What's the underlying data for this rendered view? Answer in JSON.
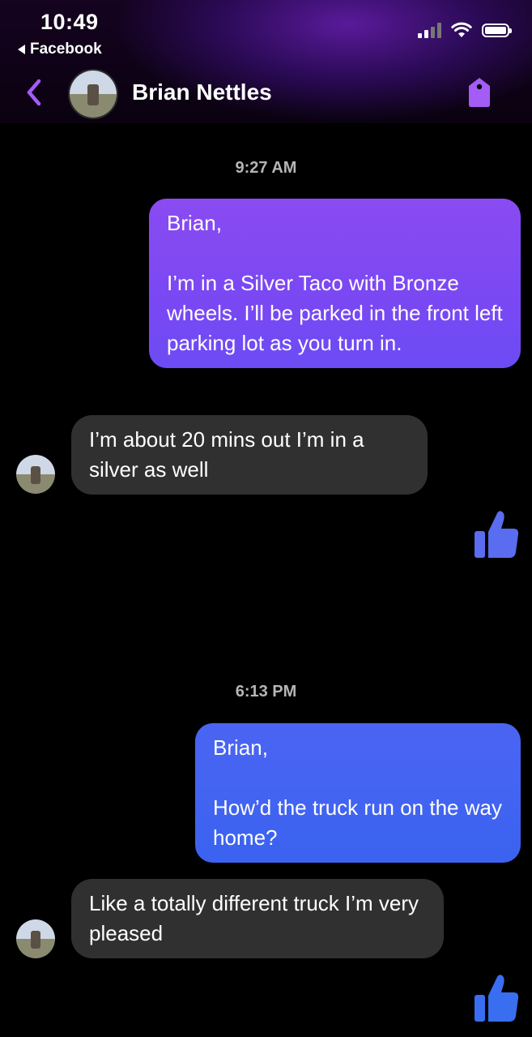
{
  "status_bar": {
    "time": "10:49",
    "back_app": "Facebook"
  },
  "header": {
    "contact_name": "Brian Nettles",
    "back_icon": "chevron-left-icon",
    "action_icon": "tag-icon"
  },
  "colors": {
    "accent": "#a45cf6",
    "outgoing_1": "#7a48f3",
    "outgoing_2": "#3a63f0",
    "incoming": "#303030",
    "like": "#5a6cf0"
  },
  "conversation": [
    {
      "type": "timestamp",
      "text": "9:27 AM"
    },
    {
      "type": "outgoing",
      "text": "Brian,\n\nI’m in a Silver Taco with Bronze wheels. I’ll be parked in the front left parking lot as you turn in."
    },
    {
      "type": "incoming",
      "text": "I’m about 20 mins out I’m in a silver as well"
    },
    {
      "type": "like",
      "icon": "thumbs-up-icon"
    },
    {
      "type": "timestamp",
      "text": "6:13 PM"
    },
    {
      "type": "outgoing",
      "text": "Brian,\n\nHow’d the truck run on the way home?"
    },
    {
      "type": "incoming",
      "text": "Like a totally different truck I’m very pleased"
    },
    {
      "type": "like",
      "icon": "thumbs-up-icon"
    }
  ]
}
